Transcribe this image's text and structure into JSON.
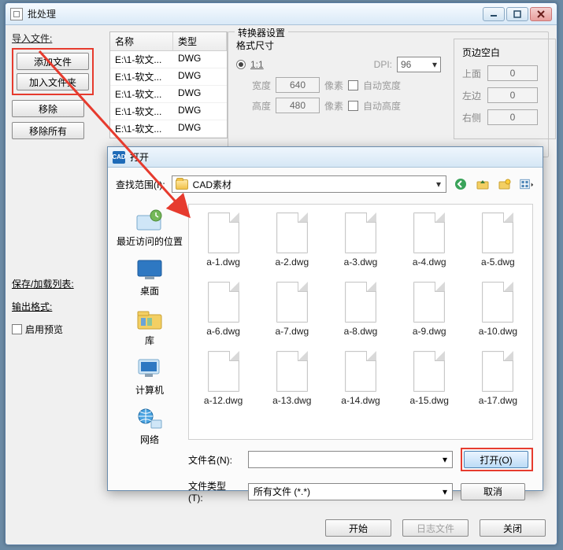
{
  "window": {
    "title": "批处理"
  },
  "left": {
    "import_label": "导入文件:",
    "add_file": "添加文件",
    "add_folder": "加入文件夹",
    "remove": "移除",
    "remove_all": "移除所有",
    "save_list": "保存/加载列表:",
    "out_fmt": "输出格式:",
    "enable_preview": "启用预览"
  },
  "table": {
    "col_name": "名称",
    "col_type": "类型",
    "rows": [
      {
        "name": "E:\\1-软文...",
        "type": "DWG"
      },
      {
        "name": "E:\\1-软文...",
        "type": "DWG"
      },
      {
        "name": "E:\\1-软文...",
        "type": "DWG"
      },
      {
        "name": "E:\\1-软文...",
        "type": "DWG"
      },
      {
        "name": "E:\\1-软文...",
        "type": "DWG"
      }
    ]
  },
  "conv": {
    "title": "转换器设置",
    "fmt_title": "格式尺寸",
    "ratio": "1:1",
    "dpi_lbl": "DPI:",
    "dpi_val": "96",
    "w_lbl": "宽度",
    "w_val": "640",
    "h_lbl": "高度",
    "h_val": "480",
    "px": "像素",
    "auto_w": "自动宽度",
    "auto_h": "自动高度",
    "margin_title": "页边空白",
    "m_top": "上面",
    "m_left": "左边",
    "m_right": "右侧",
    "m_zero": "0"
  },
  "bottom": {
    "start": "开始",
    "logs": "日志文件",
    "close": "关闭"
  },
  "open": {
    "title": "打开",
    "scope_lbl": "查找范围(I):",
    "scope_val": "CAD素材",
    "places": {
      "recent": "最近访问的位置",
      "desktop": "桌面",
      "library": "库",
      "computer": "计算机",
      "network": "网络"
    },
    "files": [
      "a-1.dwg",
      "a-2.dwg",
      "a-3.dwg",
      "a-4.dwg",
      "a-5.dwg",
      "a-6.dwg",
      "a-7.dwg",
      "a-8.dwg",
      "a-9.dwg",
      "a-10.dwg",
      "a-12.dwg",
      "a-13.dwg",
      "a-14.dwg",
      "a-15.dwg",
      "a-17.dwg"
    ],
    "fname_lbl": "文件名(N):",
    "ftype_lbl": "文件类型(T):",
    "ftype_val": "所有文件 (*.*)",
    "open_btn": "打开(O)",
    "cancel_btn": "取消"
  }
}
